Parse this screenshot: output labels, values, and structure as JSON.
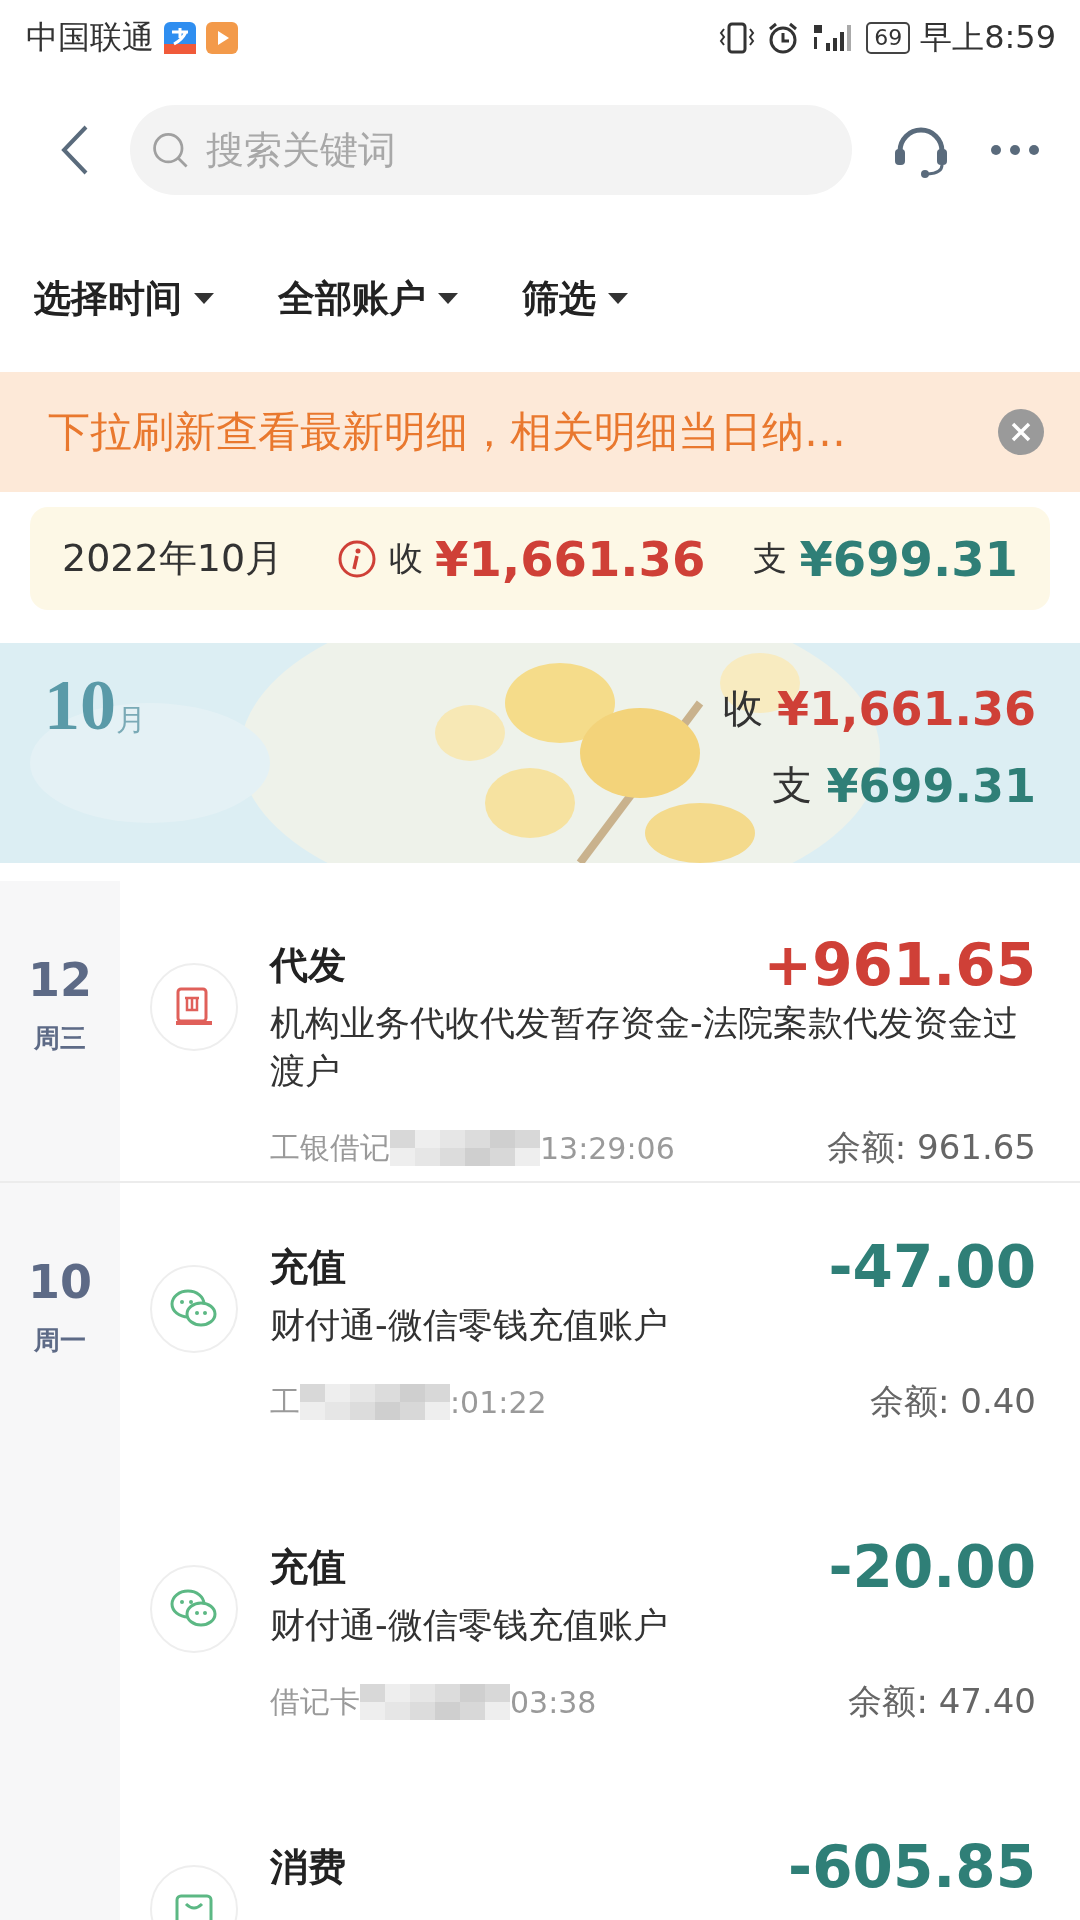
{
  "status_bar": {
    "carrier": "中国联通",
    "battery": "69",
    "time": "早上8:59"
  },
  "nav": {
    "search": {
      "placeholder": "搜索关键词"
    }
  },
  "filters": [
    {
      "label": "选择时间"
    },
    {
      "label": "全部账户"
    },
    {
      "label": "筛选"
    }
  ],
  "notice": {
    "text": "下拉刷新查看最新明细，相关明细当日纳…"
  },
  "summary": {
    "month": "2022年10月",
    "income_label": "收",
    "income": "¥1,661.36",
    "expense_label": "支",
    "expense": "¥699.31"
  },
  "month_banner": {
    "month": "10",
    "unit": "月",
    "income_label": "收",
    "income": "¥1,661.36",
    "expense_label": "支",
    "expense": "¥699.31"
  },
  "days": [
    {
      "day": "12",
      "weekday": "周三",
      "transactions": [
        {
          "kind": "agent",
          "title": "代发",
          "amount": "+961.65",
          "income": true,
          "description": "机构业务代收代发暂存资金-法院案款代发资金过渡户",
          "card": "工银借记",
          "time": "13:29:06",
          "balance": "余额: 961.65"
        }
      ]
    },
    {
      "day": "10",
      "weekday": "周一",
      "transactions": [
        {
          "kind": "wechat",
          "title": "充值",
          "amount": "-47.00",
          "income": false,
          "description": "财付通-微信零钱充值账户",
          "card": "工",
          "time": ":01:22",
          "balance": "余额: 0.40"
        },
        {
          "kind": "wechat",
          "title": "充值",
          "amount": "-20.00",
          "income": false,
          "description": "财付通-微信零钱充值账户",
          "card": "借记卡",
          "time": "03:38",
          "balance": "余额: 47.40"
        },
        {
          "kind": "shopping",
          "title": "消费",
          "amount": "-605.85",
          "income": false
        }
      ]
    }
  ]
}
